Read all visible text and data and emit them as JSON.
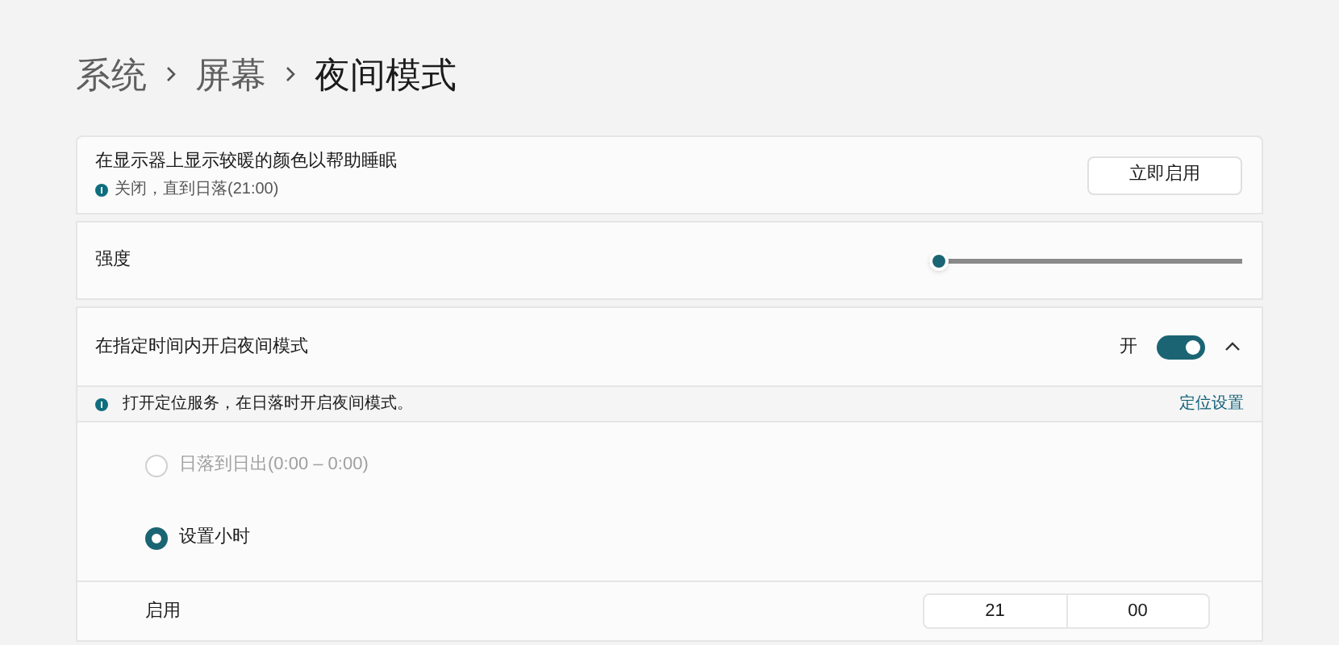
{
  "breadcrumb": [
    "系统",
    "屏幕",
    "夜间模式"
  ],
  "status_card": {
    "title": "在显示器上显示较暖的颜色以帮助睡眠",
    "status": "关闭，直到日落(21:00)",
    "button": "立即启用"
  },
  "strength": {
    "label": "强度",
    "level": 0
  },
  "schedule": {
    "label": "在指定时间内开启夜间模式",
    "toggle_label": "开",
    "on": true,
    "expanded": true,
    "notice": "打开定位服务，在日落时开启夜间模式。",
    "notice_link": "定位设置",
    "options": [
      {
        "label": "日落到日出(0:00 – 0:00)",
        "selected": false,
        "disabled": true
      },
      {
        "label": "设置小时",
        "selected": true,
        "disabled": false
      }
    ],
    "start": {
      "label": "启用",
      "hour": "21",
      "minute": "00"
    }
  }
}
